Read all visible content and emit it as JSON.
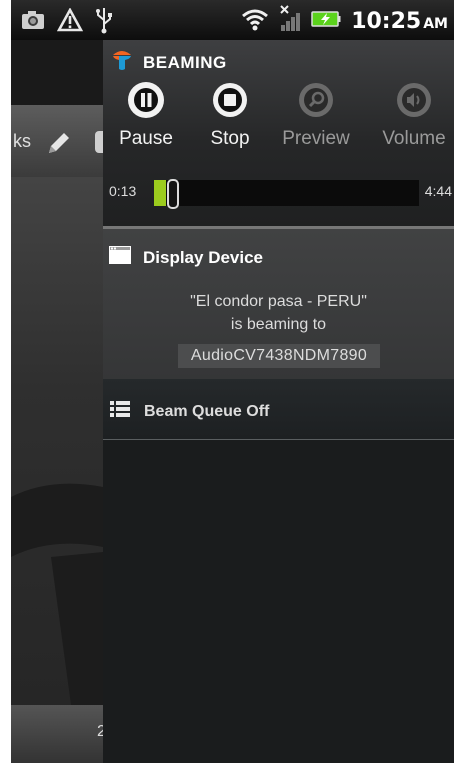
{
  "status_bar": {
    "icons": [
      "camera-icon",
      "alert-triangle-icon",
      "usb-icon",
      "wifi-icon",
      "signal-icon",
      "battery-charging-icon"
    ],
    "time": "10:25",
    "ampm": "AM"
  },
  "background_app": {
    "partial_text": "ks",
    "icons": [
      "pencil-icon"
    ]
  },
  "beaming": {
    "title": "BEAMING",
    "controls": [
      {
        "label": "Pause",
        "icon": "pause-icon",
        "enabled": true
      },
      {
        "label": "Stop",
        "icon": "stop-icon",
        "enabled": true
      },
      {
        "label": "Preview",
        "icon": "search-icon",
        "enabled": false
      },
      {
        "label": "Volume",
        "icon": "volume-icon",
        "enabled": false
      }
    ],
    "progress": {
      "elapsed": "0:13",
      "total": "4:44",
      "fraction": 0.046
    }
  },
  "display_device": {
    "title": "Display Device",
    "song": "\"El condor pasa - PERU\"",
    "beaming_to": "is beaming to",
    "device": "AudioCV7438NDM7890"
  },
  "beam_queue": {
    "title": "Beam Queue Off"
  },
  "colors": {
    "accent_green": "#9ccc1e",
    "app_logo_orange": "#f26522",
    "app_logo_blue": "#1e9ad6",
    "battery_green": "#5bd21c",
    "disabled_label": "#9a9a9a"
  }
}
